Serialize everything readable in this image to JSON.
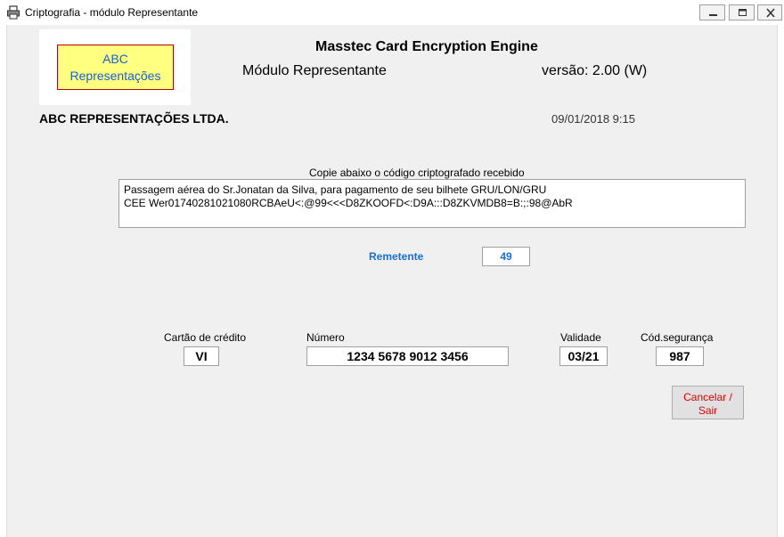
{
  "window": {
    "title": "Criptografia - módulo Representante",
    "icon": "printer-lock-icon"
  },
  "logo": {
    "line1": "ABC",
    "line2": "Representações"
  },
  "header": {
    "app_title": "Masstec Card Encryption Engine",
    "module": "Módulo Representante",
    "version": "versão:  2.00 (W)",
    "company": "ABC REPRESENTAÇÕES LTDA.",
    "datetime": "09/01/2018 9:15"
  },
  "encrypted": {
    "label": "Copie abaixo o código criptografado recebido",
    "line1": "Passagem aérea do Sr.Jonatan da Silva, para pagamento de seu bilhete GRU/LON/GRU",
    "line2": "CEE Wer01740281021080RCBAeU<:@99<<<D8ZKOOFD<:D9A:::D8ZKVMDB8=B:;:98@AbR"
  },
  "sender": {
    "label": "Remetente",
    "value": "49"
  },
  "card": {
    "type_label": "Cartão de crédito",
    "type_value": "VI",
    "number_label": "Número",
    "number_value": "1234  5678  9012  3456",
    "validity_label": "Validade",
    "validity_value": "03/21",
    "cvv_label": "Cód.segurança",
    "cvv_value": "987"
  },
  "buttons": {
    "cancel_line1": "Cancelar /",
    "cancel_line2": "Sair"
  },
  "colors": {
    "accent_blue": "#1a6fd0",
    "cancel_red": "#e00000",
    "logo_fill": "#ffff80",
    "logo_border": "#c00000"
  }
}
